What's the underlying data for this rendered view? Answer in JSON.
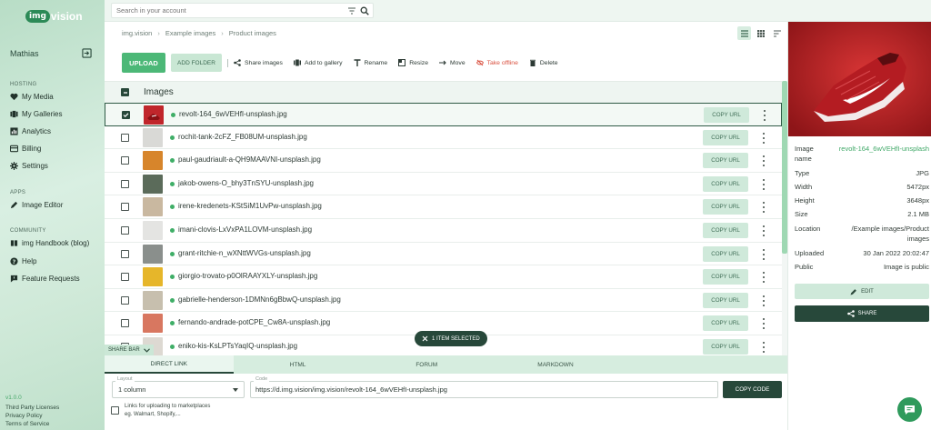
{
  "app": {
    "logo_badge": "img",
    "logo_text": "vision"
  },
  "sidebar": {
    "user_name": "Mathias",
    "sections": [
      {
        "title": "HOSTING",
        "items": [
          {
            "label": "My Media",
            "icon": "heart-icon"
          },
          {
            "label": "My Galleries",
            "icon": "gallery-icon"
          },
          {
            "label": "Analytics",
            "icon": "analytics-icon"
          },
          {
            "label": "Billing",
            "icon": "billing-icon"
          },
          {
            "label": "Settings",
            "icon": "gear-icon"
          }
        ]
      },
      {
        "title": "APPS",
        "items": [
          {
            "label": "Image Editor",
            "icon": "pencil-icon"
          }
        ]
      },
      {
        "title": "COMMUNITY",
        "items": [
          {
            "label": "img Handbook (blog)",
            "icon": "book-icon"
          },
          {
            "label": "Help",
            "icon": "help-icon"
          },
          {
            "label": "Feature Requests",
            "icon": "feedback-icon"
          }
        ]
      }
    ],
    "footer": {
      "version": "v1.0.0",
      "links": [
        "Third Party Licenses",
        "Privacy Policy",
        "Terms of Service"
      ]
    }
  },
  "search": {
    "placeholder": "Search in your account"
  },
  "breadcrumb": [
    "img.vision",
    "Example images",
    "Product images"
  ],
  "toolbar": {
    "upload": "UPLOAD",
    "add_folder": "ADD FOLDER",
    "actions": [
      {
        "label": "Share images",
        "icon": "share-icon"
      },
      {
        "label": "Add to gallery",
        "icon": "gallery-icon"
      },
      {
        "label": "Rename",
        "icon": "text-icon"
      },
      {
        "label": "Resize",
        "icon": "resize-icon"
      },
      {
        "label": "Move",
        "icon": "arrow-right-icon"
      },
      {
        "label": "Take offline",
        "icon": "eye-off-icon"
      },
      {
        "label": "Delete",
        "icon": "trash-icon"
      }
    ]
  },
  "list": {
    "header": "Images",
    "copy_label": "COPY URL",
    "rows": [
      {
        "name": "revolt-164_6wVEHfI-unsplash.jpg",
        "selected": true,
        "thumb": "#c0262b"
      },
      {
        "name": "rochit-tank-2cFZ_FB08UM-unsplash.jpg",
        "selected": false,
        "thumb": "#d9d9d6"
      },
      {
        "name": "paul-gaudriault-a-QH9MAAVNI-unsplash.jpg",
        "selected": false,
        "thumb": "#d7852b"
      },
      {
        "name": "jakob-owens-O_bhy3TnSYU-unsplash.jpg",
        "selected": false,
        "thumb": "#5b6b5a"
      },
      {
        "name": "irene-kredenets-KStSiM1UvPw-unsplash.jpg",
        "selected": false,
        "thumb": "#c9b8a0"
      },
      {
        "name": "imani-clovis-LxVxPA1LOVM-unsplash.jpg",
        "selected": false,
        "thumb": "#e4e4e2"
      },
      {
        "name": "grant-ritchie-n_wXNttWVGs-unsplash.jpg",
        "selected": false,
        "thumb": "#8a8f8c"
      },
      {
        "name": "giorgio-trovato-p0OlRAAYXLY-unsplash.jpg",
        "selected": false,
        "thumb": "#e6b62a"
      },
      {
        "name": "gabrielle-henderson-1DMNn6gBbwQ-unsplash.jpg",
        "selected": false,
        "thumb": "#c7bfae"
      },
      {
        "name": "fernando-andrade-potCPE_Cw8A-unsplash.jpg",
        "selected": false,
        "thumb": "#d87760"
      },
      {
        "name": "eniko-kis-KsLPTsYaqIQ-unsplash.jpg",
        "selected": false,
        "thumb": "#ddd9d2"
      }
    ]
  },
  "selection_pill": "1 ITEM SELECTED",
  "share_bar": {
    "toggle_label": "SHARE BAR",
    "tabs": [
      "DIRECT LINK",
      "HTML",
      "FORUM",
      "MARKDOWN",
      ""
    ],
    "layout_label": "Layout",
    "layout_value": "1 column",
    "code_label": "Code",
    "code_value": "https://d.img.vision/img.vision/revolt-164_6wVEHfI-unsplash.jpg",
    "copy_code": "COPY CODE",
    "marketplace_line1": "Links for uploading to marketplaces",
    "marketplace_line2": "eg. Walmart, Shopify,..."
  },
  "details": {
    "rows": [
      {
        "label": "Image name",
        "value": "revolt-164_6wVEHfI-unsplash",
        "green": true
      },
      {
        "label": "Type",
        "value": "JPG"
      },
      {
        "label": "Width",
        "value": "5472px"
      },
      {
        "label": "Height",
        "value": "3648px"
      },
      {
        "label": "Size",
        "value": "2.1 MB"
      },
      {
        "label": "Location",
        "value": "/Example images/Product images"
      },
      {
        "label": "Uploaded",
        "value": "30 Jan 2022 20:02:47"
      },
      {
        "label": "Public",
        "value": "Image is public"
      }
    ],
    "edit": "EDIT",
    "share": "SHARE"
  },
  "colors": {
    "accent": "#4cb877",
    "dark": "#27483a",
    "light_button": "#cfe9da",
    "warn": "#d9503f"
  }
}
